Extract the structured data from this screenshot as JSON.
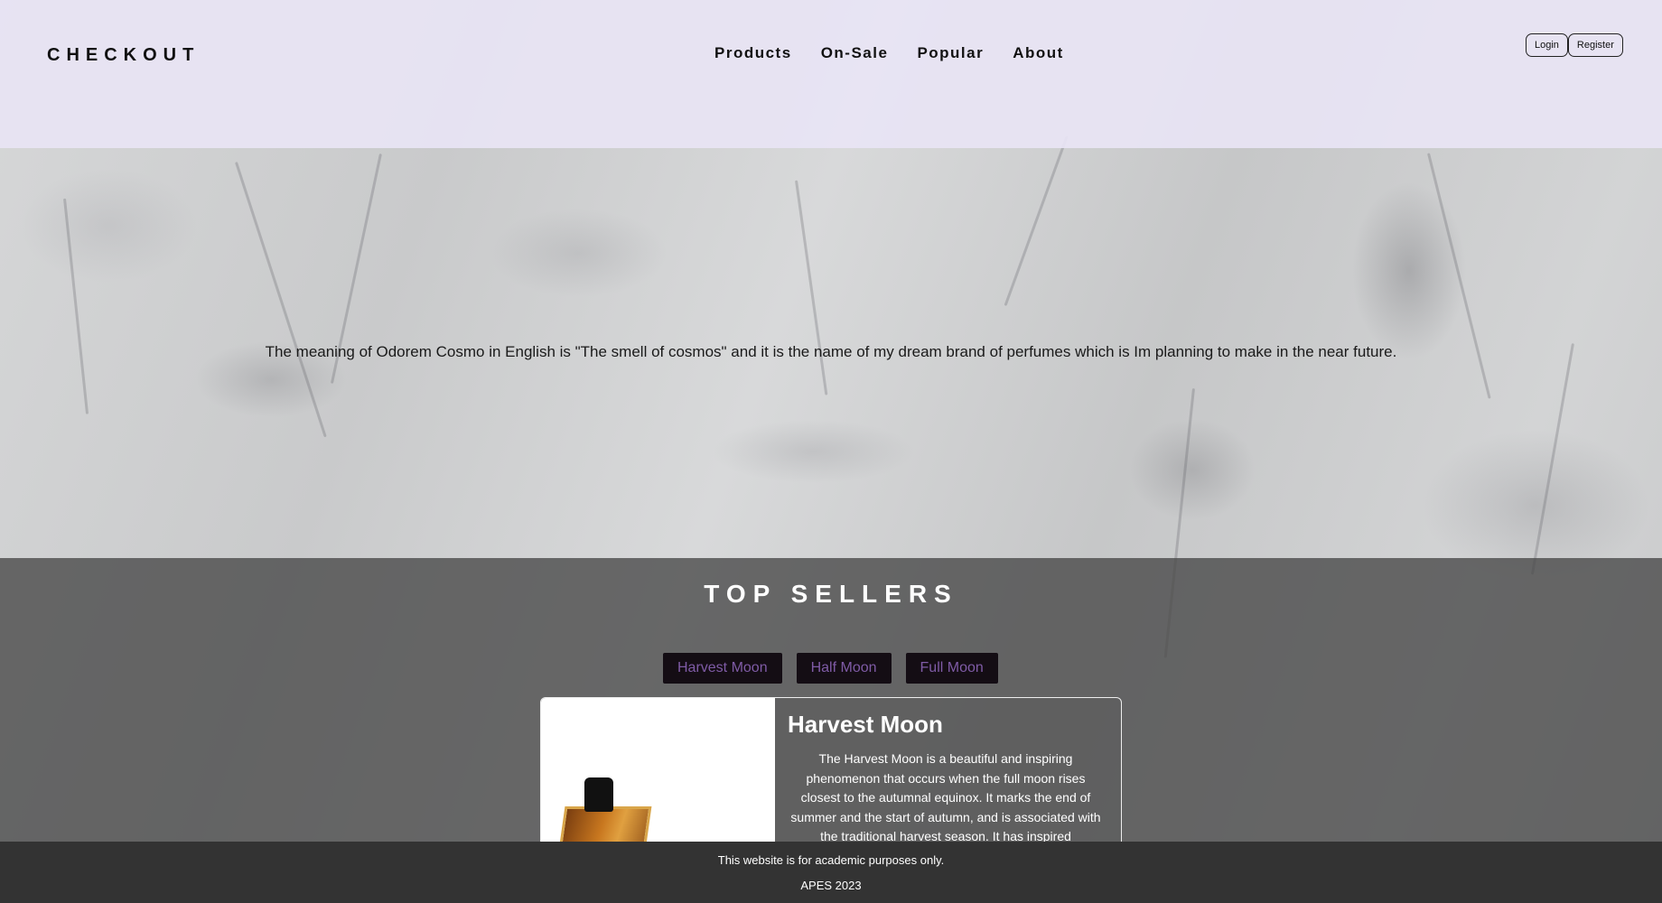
{
  "header": {
    "brand": "CHECKOUT",
    "nav": [
      "Products",
      "On-Sale",
      "Popular",
      "About"
    ],
    "login_label": "Login",
    "register_label": "Register"
  },
  "hero": {
    "text": "The meaning of Odorem Cosmo in English is \"The smell of cosmos\" and it is the name of my dream brand of perfumes which is Im planning to make in the near future."
  },
  "top_sellers": {
    "title": "TOP SELLERS",
    "tabs": [
      "Harvest Moon",
      "Half Moon",
      "Full Moon"
    ],
    "card": {
      "title": "Harvest Moon",
      "description": "The Harvest Moon is a beautiful and inspiring phenomenon that occurs when the full moon rises closest to the autumnal equinox. It marks the end of summer and the start of autumn, and is associated with the traditional harvest season. It has inspired"
    }
  },
  "footer": {
    "line1": "This website is for academic purposes only.",
    "line2": "APES 2023"
  },
  "colors": {
    "header_bg": "#e8e4f4",
    "tab_bg": "#140d14",
    "tab_text": "#7f5ba6",
    "footer_bg": "#333333"
  }
}
